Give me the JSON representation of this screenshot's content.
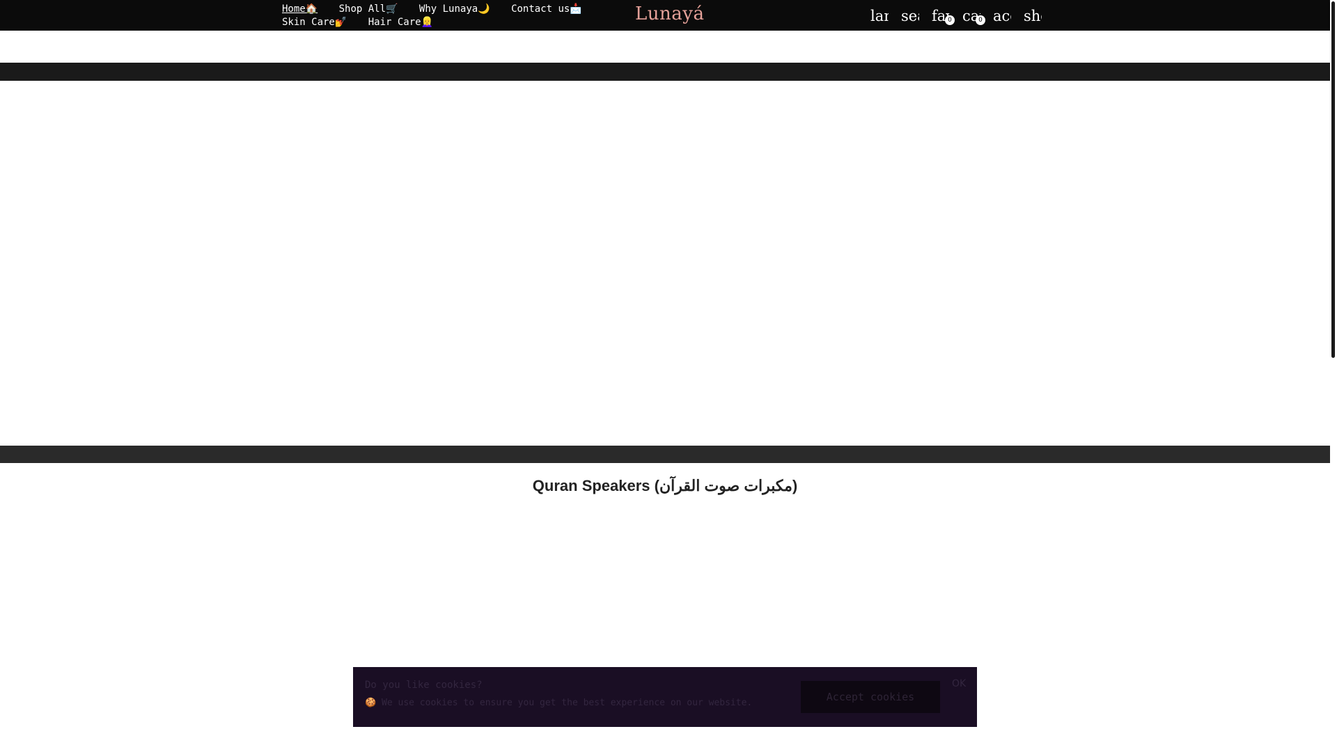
{
  "nav": {
    "items": [
      {
        "label": "Home🏠"
      },
      {
        "label": "Shop All🛒"
      },
      {
        "label": "Why Lunaya🌙"
      },
      {
        "label": "Contact us📩"
      },
      {
        "label": "Skin Care💅"
      },
      {
        "label": "Hair Care👱‍♀️"
      }
    ]
  },
  "brand": {
    "logo": "Lunayá",
    "logo_color": "#e5a199"
  },
  "header_icons": [
    {
      "label": "language",
      "icon": "language-icon"
    },
    {
      "label": "search",
      "icon": "search-icon"
    },
    {
      "label": "favorites",
      "icon": "heart-icon",
      "count": "0"
    },
    {
      "label": "cart",
      "icon": "cart-icon",
      "count": "0"
    },
    {
      "label": "account",
      "icon": "account-icon"
    },
    {
      "label": "shop",
      "icon": "shop-icon"
    }
  ],
  "collection": {
    "title": "Quran Speakers (مكبرات صوت القرآن)"
  },
  "cookie": {
    "title": "Do you like cookies?",
    "text": "We use cookies to ensure you get the best experience on our website.",
    "accept_label": "Accept cookies",
    "close_label": "OK"
  }
}
